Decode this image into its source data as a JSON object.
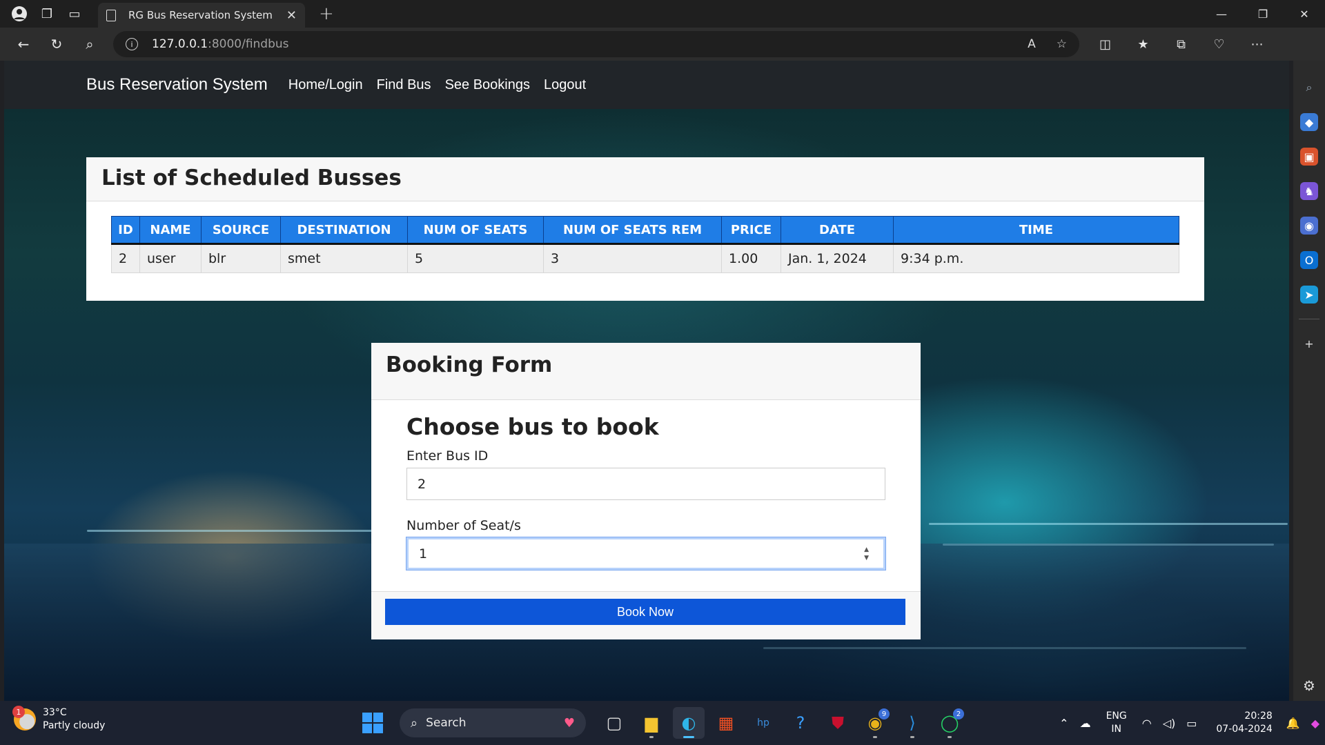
{
  "browser": {
    "tab_title": "RG Bus Reservation System",
    "url_host": "127.0.0.1",
    "url_path": ":8000/findbus"
  },
  "navbar": {
    "brand": "Bus Reservation System",
    "links": [
      "Home/Login",
      "Find Bus",
      "See Bookings",
      "Logout"
    ]
  },
  "busses": {
    "title": "List of Scheduled Busses",
    "columns": [
      "ID",
      "NAME",
      "SOURCE",
      "DESTINATION",
      "NUM OF SEATS",
      "NUM OF SEATS REM",
      "PRICE",
      "DATE",
      "TIME"
    ],
    "rows": [
      [
        "2",
        "user",
        "blr",
        "smet",
        "5",
        "3",
        "1.00",
        "Jan. 1, 2024",
        "9:34 p.m."
      ]
    ]
  },
  "booking": {
    "title": "Booking Form",
    "heading": "Choose bus to book",
    "bus_id_label": "Enter Bus ID",
    "bus_id_value": "2",
    "seats_label": "Number of Seat/s",
    "seats_value": "1",
    "submit_label": "Book Now"
  },
  "taskbar": {
    "weather_badge": "1",
    "temperature": "33°C",
    "weather": "Partly cloudy",
    "search_label": "Search",
    "lang_line1": "ENG",
    "lang_line2": "IN",
    "time": "20:28",
    "date": "07-04-2024",
    "chrome_badge": "9",
    "whatsapp_badge": "2"
  },
  "colors": {
    "table_header": "#1f7de6",
    "book_button": "#0d56d8",
    "navbar": "#212529"
  }
}
